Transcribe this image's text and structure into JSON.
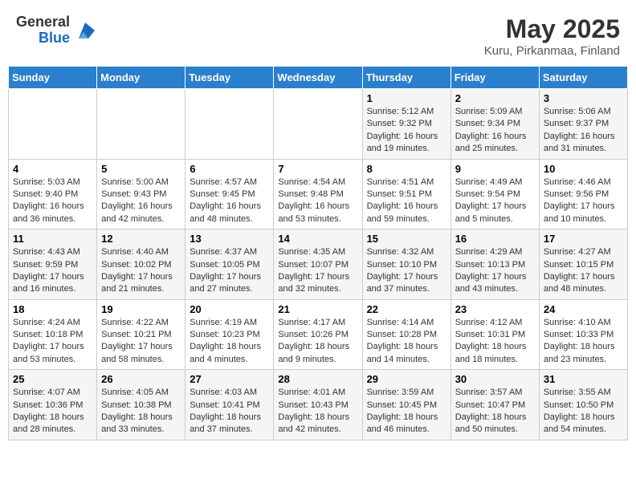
{
  "header": {
    "logo_general": "General",
    "logo_blue": "Blue",
    "month_title": "May 2025",
    "location": "Kuru, Pirkanmaa, Finland"
  },
  "weekdays": [
    "Sunday",
    "Monday",
    "Tuesday",
    "Wednesday",
    "Thursday",
    "Friday",
    "Saturday"
  ],
  "weeks": [
    [
      {
        "day": "",
        "info": ""
      },
      {
        "day": "",
        "info": ""
      },
      {
        "day": "",
        "info": ""
      },
      {
        "day": "",
        "info": ""
      },
      {
        "day": "1",
        "info": "Sunrise: 5:12 AM\nSunset: 9:32 PM\nDaylight: 16 hours and 19 minutes."
      },
      {
        "day": "2",
        "info": "Sunrise: 5:09 AM\nSunset: 9:34 PM\nDaylight: 16 hours and 25 minutes."
      },
      {
        "day": "3",
        "info": "Sunrise: 5:06 AM\nSunset: 9:37 PM\nDaylight: 16 hours and 31 minutes."
      }
    ],
    [
      {
        "day": "4",
        "info": "Sunrise: 5:03 AM\nSunset: 9:40 PM\nDaylight: 16 hours and 36 minutes."
      },
      {
        "day": "5",
        "info": "Sunrise: 5:00 AM\nSunset: 9:43 PM\nDaylight: 16 hours and 42 minutes."
      },
      {
        "day": "6",
        "info": "Sunrise: 4:57 AM\nSunset: 9:45 PM\nDaylight: 16 hours and 48 minutes."
      },
      {
        "day": "7",
        "info": "Sunrise: 4:54 AM\nSunset: 9:48 PM\nDaylight: 16 hours and 53 minutes."
      },
      {
        "day": "8",
        "info": "Sunrise: 4:51 AM\nSunset: 9:51 PM\nDaylight: 16 hours and 59 minutes."
      },
      {
        "day": "9",
        "info": "Sunrise: 4:49 AM\nSunset: 9:54 PM\nDaylight: 17 hours and 5 minutes."
      },
      {
        "day": "10",
        "info": "Sunrise: 4:46 AM\nSunset: 9:56 PM\nDaylight: 17 hours and 10 minutes."
      }
    ],
    [
      {
        "day": "11",
        "info": "Sunrise: 4:43 AM\nSunset: 9:59 PM\nDaylight: 17 hours and 16 minutes."
      },
      {
        "day": "12",
        "info": "Sunrise: 4:40 AM\nSunset: 10:02 PM\nDaylight: 17 hours and 21 minutes."
      },
      {
        "day": "13",
        "info": "Sunrise: 4:37 AM\nSunset: 10:05 PM\nDaylight: 17 hours and 27 minutes."
      },
      {
        "day": "14",
        "info": "Sunrise: 4:35 AM\nSunset: 10:07 PM\nDaylight: 17 hours and 32 minutes."
      },
      {
        "day": "15",
        "info": "Sunrise: 4:32 AM\nSunset: 10:10 PM\nDaylight: 17 hours and 37 minutes."
      },
      {
        "day": "16",
        "info": "Sunrise: 4:29 AM\nSunset: 10:13 PM\nDaylight: 17 hours and 43 minutes."
      },
      {
        "day": "17",
        "info": "Sunrise: 4:27 AM\nSunset: 10:15 PM\nDaylight: 17 hours and 48 minutes."
      }
    ],
    [
      {
        "day": "18",
        "info": "Sunrise: 4:24 AM\nSunset: 10:18 PM\nDaylight: 17 hours and 53 minutes."
      },
      {
        "day": "19",
        "info": "Sunrise: 4:22 AM\nSunset: 10:21 PM\nDaylight: 17 hours and 58 minutes."
      },
      {
        "day": "20",
        "info": "Sunrise: 4:19 AM\nSunset: 10:23 PM\nDaylight: 18 hours and 4 minutes."
      },
      {
        "day": "21",
        "info": "Sunrise: 4:17 AM\nSunset: 10:26 PM\nDaylight: 18 hours and 9 minutes."
      },
      {
        "day": "22",
        "info": "Sunrise: 4:14 AM\nSunset: 10:28 PM\nDaylight: 18 hours and 14 minutes."
      },
      {
        "day": "23",
        "info": "Sunrise: 4:12 AM\nSunset: 10:31 PM\nDaylight: 18 hours and 18 minutes."
      },
      {
        "day": "24",
        "info": "Sunrise: 4:10 AM\nSunset: 10:33 PM\nDaylight: 18 hours and 23 minutes."
      }
    ],
    [
      {
        "day": "25",
        "info": "Sunrise: 4:07 AM\nSunset: 10:36 PM\nDaylight: 18 hours and 28 minutes."
      },
      {
        "day": "26",
        "info": "Sunrise: 4:05 AM\nSunset: 10:38 PM\nDaylight: 18 hours and 33 minutes."
      },
      {
        "day": "27",
        "info": "Sunrise: 4:03 AM\nSunset: 10:41 PM\nDaylight: 18 hours and 37 minutes."
      },
      {
        "day": "28",
        "info": "Sunrise: 4:01 AM\nSunset: 10:43 PM\nDaylight: 18 hours and 42 minutes."
      },
      {
        "day": "29",
        "info": "Sunrise: 3:59 AM\nSunset: 10:45 PM\nDaylight: 18 hours and 46 minutes."
      },
      {
        "day": "30",
        "info": "Sunrise: 3:57 AM\nSunset: 10:47 PM\nDaylight: 18 hours and 50 minutes."
      },
      {
        "day": "31",
        "info": "Sunrise: 3:55 AM\nSunset: 10:50 PM\nDaylight: 18 hours and 54 minutes."
      }
    ]
  ]
}
